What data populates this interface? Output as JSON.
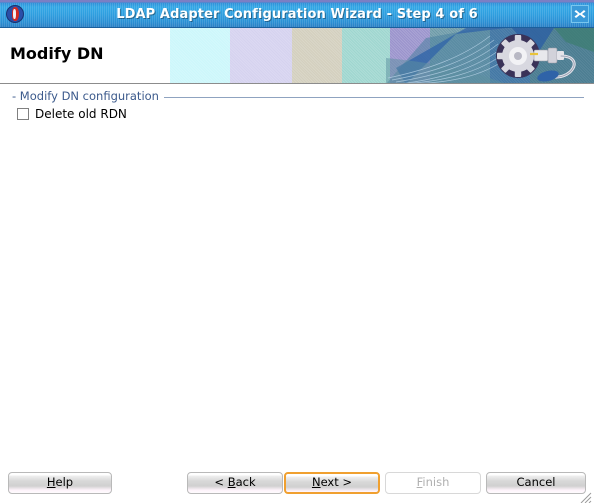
{
  "window": {
    "title": "LDAP Adapter Configuration Wizard - Step 4 of 6",
    "icon": "oracle-logo-icon",
    "close_icon": "close-icon"
  },
  "banner": {
    "title": "Modify DN",
    "graphic": "gear-connector-icon",
    "colors": {
      "white": "#ffffff",
      "cyan": "#ccf7fb",
      "lavender": "#d5d2ef",
      "beige": "#d3cfbe",
      "teal": "#9ed6cf",
      "purple": "#9a93cc",
      "slate": "#6d9aa8",
      "blue": "#3b6fae",
      "deep_teal": "#4d7a82"
    }
  },
  "content": {
    "section": {
      "label": "- Modify DN configuration"
    },
    "checkbox": {
      "label": "Delete old RDN",
      "checked": false
    }
  },
  "buttons": {
    "help": {
      "label": "Help",
      "mnemonic": "H",
      "before": "",
      "after": "elp",
      "enabled": true,
      "focused": false
    },
    "back": {
      "label": "< Back",
      "mnemonic": "B",
      "before": "< ",
      "after": "ack",
      "enabled": true,
      "focused": false
    },
    "next": {
      "label": "Next >",
      "mnemonic": "N",
      "before": "",
      "after": "ext >",
      "enabled": true,
      "focused": true
    },
    "finish": {
      "label": "Finish",
      "mnemonic": "F",
      "before": "",
      "after": "inish",
      "enabled": false,
      "focused": false
    },
    "cancel": {
      "label": "Cancel",
      "mnemonic": "",
      "before": "Cancel",
      "after": "",
      "enabled": true,
      "focused": false
    }
  },
  "colors": {
    "titlebar_blue": "#31a7e6",
    "focus_orange": "#f0a030",
    "section_label_blue": "#3c5a8c",
    "disabled_text": "#b0b0b0"
  }
}
